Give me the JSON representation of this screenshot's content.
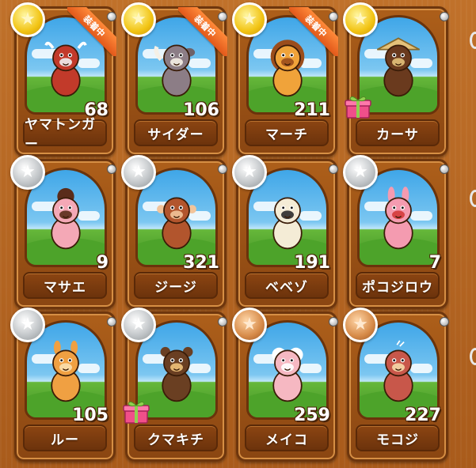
{
  "badge_text": "装着中",
  "cards": [
    {
      "name": "ヤマトンガー",
      "count": "68",
      "medal": "gold",
      "equipped": true,
      "gift": false,
      "creature": "warrior-mask",
      "body": "#c23a2a",
      "accent": "#f0f0f0"
    },
    {
      "name": "サイダー",
      "count": "106",
      "medal": "gold",
      "equipped": true,
      "gift": false,
      "creature": "rhino",
      "body": "#8c7d86",
      "accent": "#f5f0e6"
    },
    {
      "name": "マーチ",
      "count": "211",
      "medal": "gold",
      "equipped": true,
      "gift": false,
      "creature": "lion",
      "body": "#f0a33a",
      "accent": "#9b4d1c"
    },
    {
      "name": "カーサ",
      "count": "",
      "medal": "gold",
      "equipped": false,
      "gift": true,
      "creature": "straw-hat",
      "body": "#6a3a1e",
      "accent": "#e4c27a"
    },
    {
      "name": "マサエ",
      "count": "9",
      "medal": "silver",
      "equipped": false,
      "gift": false,
      "creature": "kimono",
      "body": "#f4a8b6",
      "accent": "#5a2c1a"
    },
    {
      "name": "ジージ",
      "count": "321",
      "medal": "silver",
      "equipped": false,
      "gift": false,
      "creature": "monkey",
      "body": "#b2552d",
      "accent": "#f2c49a"
    },
    {
      "name": "ベベゾ",
      "count": "191",
      "medal": "silver",
      "equipped": false,
      "gift": false,
      "creature": "zebra",
      "body": "#f4ecd6",
      "accent": "#2b2b2b"
    },
    {
      "name": "ポコジロウ",
      "count": "7",
      "medal": "silver",
      "equipped": false,
      "gift": false,
      "creature": "rabbit",
      "body": "#f49bb0",
      "accent": "#d43a3a"
    },
    {
      "name": "ルー",
      "count": "105",
      "medal": "silver",
      "equipped": false,
      "gift": false,
      "creature": "kangaroo",
      "body": "#f0a042",
      "accent": "#fbe0b0"
    },
    {
      "name": "クマキチ",
      "count": "",
      "medal": "silver",
      "equipped": false,
      "gift": true,
      "creature": "bear",
      "body": "#6a3f22",
      "accent": "#f0c27a"
    },
    {
      "name": "メイコ",
      "count": "259",
      "medal": "bronze",
      "equipped": false,
      "gift": false,
      "creature": "sheep",
      "body": "#f6b8c2",
      "accent": "#ffffff"
    },
    {
      "name": "モコジ",
      "count": "227",
      "medal": "bronze",
      "equipped": false,
      "gift": false,
      "creature": "owl",
      "body": "#c8574a",
      "accent": "#f5d9a8"
    }
  ]
}
